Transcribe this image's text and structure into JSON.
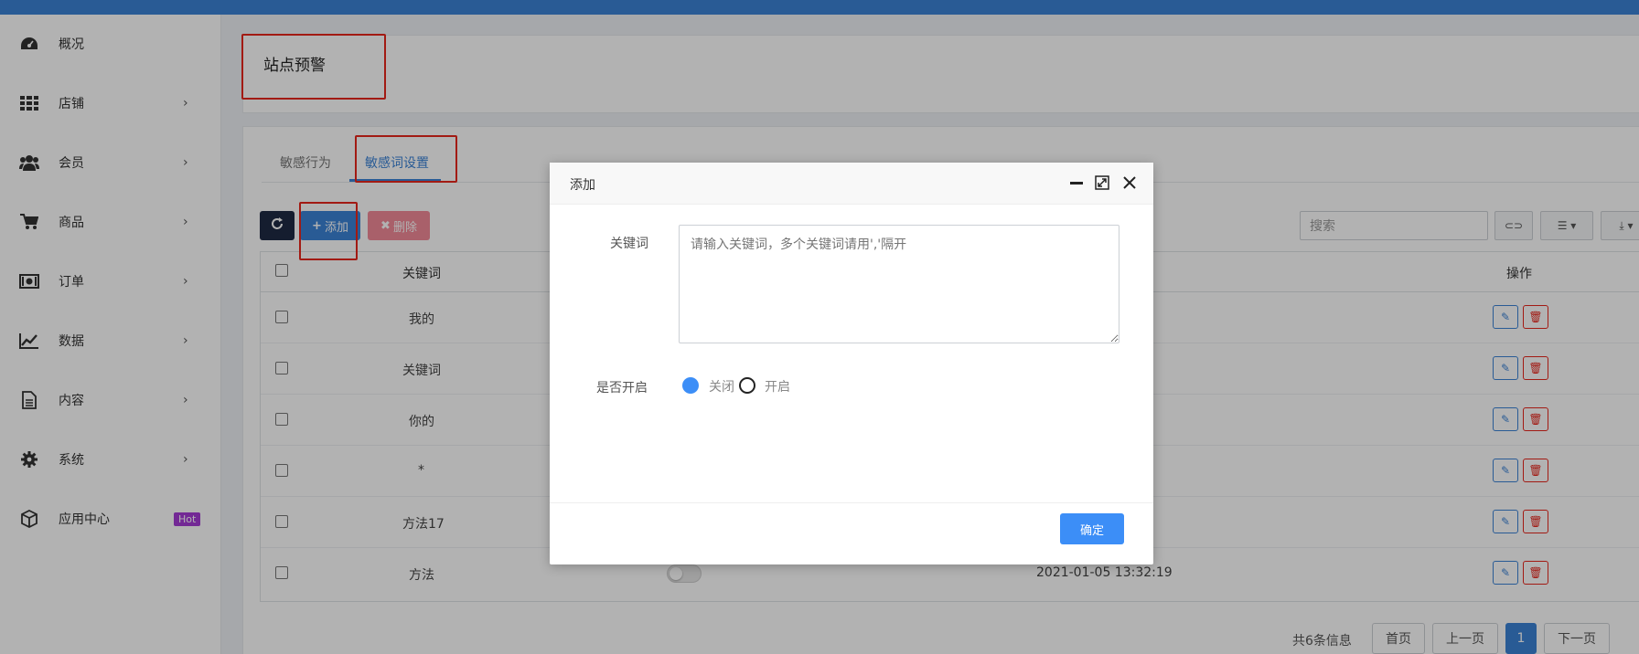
{
  "sidebar": {
    "items": [
      {
        "label": "概况",
        "icon": "dashboard-icon",
        "has_arrow": false
      },
      {
        "label": "店铺",
        "icon": "grid-icon",
        "has_arrow": true
      },
      {
        "label": "会员",
        "icon": "users-icon",
        "has_arrow": true
      },
      {
        "label": "商品",
        "icon": "cart-icon",
        "has_arrow": true
      },
      {
        "label": "订单",
        "icon": "money-icon",
        "has_arrow": true
      },
      {
        "label": "数据",
        "icon": "chart-line-icon",
        "has_arrow": true
      },
      {
        "label": "内容",
        "icon": "document-icon",
        "has_arrow": true
      },
      {
        "label": "系统",
        "icon": "gear-icon",
        "has_arrow": true
      },
      {
        "label": "应用中心",
        "icon": "cube-icon",
        "badge": "Hot"
      }
    ],
    "chevron": "›"
  },
  "page": {
    "title": "站点预警"
  },
  "tabs": [
    {
      "label": "敏感行为"
    },
    {
      "label": "敏感词设置"
    }
  ],
  "toolbar": {
    "refresh_icon": "refresh-icon",
    "add_label": "添加",
    "delete_label": "删除",
    "search_placeholder": "搜索"
  },
  "table": {
    "headers": {
      "keyword": "关键词",
      "action": "操作"
    },
    "rows": [
      {
        "keyword": "我的",
        "time": ""
      },
      {
        "keyword": "关键词",
        "time": ""
      },
      {
        "keyword": "你的",
        "time": ""
      },
      {
        "keyword": "*",
        "time": ""
      },
      {
        "keyword": "方法17",
        "time": ""
      },
      {
        "keyword": "方法",
        "time": "2021-01-05 13:32:19",
        "switch": "off"
      }
    ]
  },
  "pagination": {
    "info": "共6条信息",
    "first": "首页",
    "prev": "上一页",
    "current": "1",
    "next": "下一页"
  },
  "modal": {
    "title": "添加",
    "keyword_label": "关键词",
    "keyword_placeholder": "请输入关键词，多个关键词请用','隔开",
    "enable_label": "是否开启",
    "options": [
      {
        "label": "关闭",
        "selected": true
      },
      {
        "label": "开启",
        "selected": false
      }
    ],
    "confirm_label": "确定"
  },
  "colors": {
    "primary": "#3c83d6",
    "danger": "#e8261c",
    "hot_badge": "#a53bd6"
  }
}
